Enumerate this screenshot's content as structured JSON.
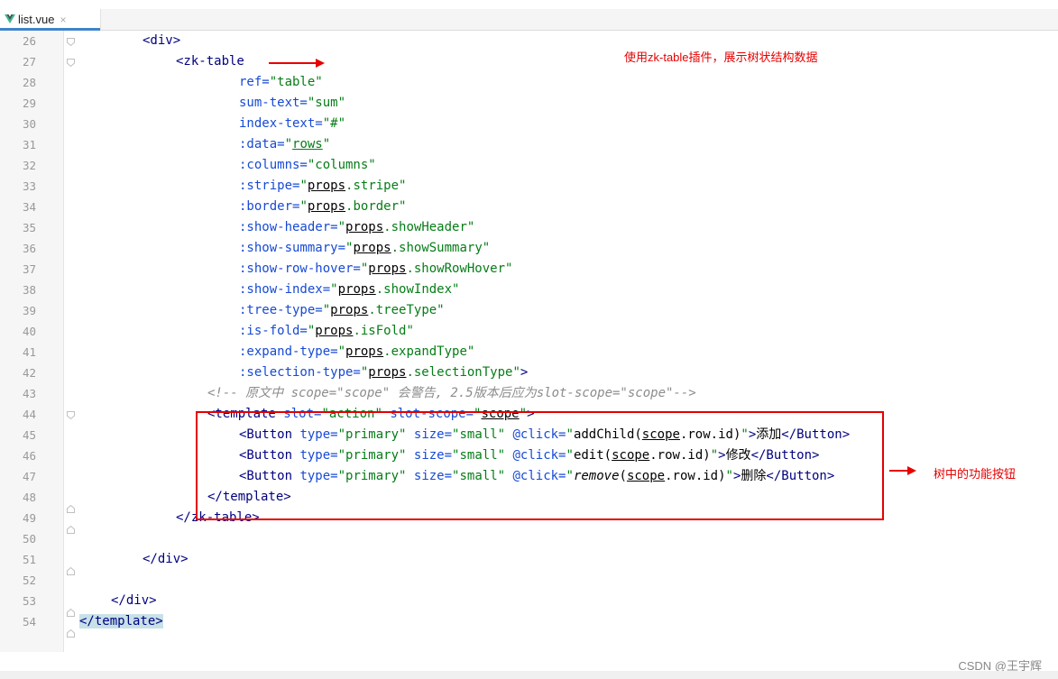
{
  "editor": {
    "tab": {
      "label": "list.vue",
      "close": "×"
    }
  },
  "annotations": {
    "top": "使用zk-table插件，展示树状结构数据",
    "right": "树中的功能按钮",
    "watermark": "CSDN @王宇辉"
  },
  "lines": [
    {
      "n": "26",
      "tokens": [
        [
          "t",
          "<div>"
        ]
      ],
      "indent": 70
    },
    {
      "n": "27",
      "tokens": [
        [
          "t",
          "<zk-table"
        ]
      ],
      "indent": 107
    },
    {
      "n": "28",
      "tokens": [
        [
          "a",
          "ref="
        ],
        [
          "s",
          "\"table\""
        ]
      ],
      "indent": 177
    },
    {
      "n": "29",
      "tokens": [
        [
          "a",
          "sum-text="
        ],
        [
          "s",
          "\"sum\""
        ]
      ],
      "indent": 177
    },
    {
      "n": "30",
      "tokens": [
        [
          "a",
          "index-text="
        ],
        [
          "s",
          "\"#\""
        ]
      ],
      "indent": 177
    },
    {
      "n": "31",
      "tokens": [
        [
          "a",
          ":data="
        ],
        [
          "s",
          "\""
        ],
        [
          "su",
          "rows"
        ],
        [
          "s",
          "\""
        ]
      ],
      "indent": 177
    },
    {
      "n": "32",
      "tokens": [
        [
          "a",
          ":columns="
        ],
        [
          "s",
          "\"columns\""
        ]
      ],
      "indent": 177
    },
    {
      "n": "33",
      "tokens": [
        [
          "a",
          ":stripe="
        ],
        [
          "s",
          "\""
        ],
        [
          "bu",
          "props"
        ],
        [
          "s",
          ".stripe\""
        ]
      ],
      "indent": 177
    },
    {
      "n": "34",
      "tokens": [
        [
          "a",
          ":border="
        ],
        [
          "s",
          "\""
        ],
        [
          "bu",
          "props"
        ],
        [
          "s",
          ".border\""
        ]
      ],
      "indent": 177
    },
    {
      "n": "35",
      "tokens": [
        [
          "a",
          ":show-header="
        ],
        [
          "s",
          "\""
        ],
        [
          "bu",
          "props"
        ],
        [
          "s",
          ".showHeader\""
        ]
      ],
      "indent": 177
    },
    {
      "n": "36",
      "tokens": [
        [
          "a",
          ":show-summary="
        ],
        [
          "s",
          "\""
        ],
        [
          "bu",
          "props"
        ],
        [
          "s",
          ".showSummary\""
        ]
      ],
      "indent": 177
    },
    {
      "n": "37",
      "tokens": [
        [
          "a",
          ":show-row-hover="
        ],
        [
          "s",
          "\""
        ],
        [
          "bu",
          "props"
        ],
        [
          "s",
          ".showRowHover\""
        ]
      ],
      "indent": 177
    },
    {
      "n": "38",
      "tokens": [
        [
          "a",
          ":show-index="
        ],
        [
          "s",
          "\""
        ],
        [
          "bu",
          "props"
        ],
        [
          "s",
          ".showIndex\""
        ]
      ],
      "indent": 177
    },
    {
      "n": "39",
      "tokens": [
        [
          "a",
          ":tree-type="
        ],
        [
          "s",
          "\""
        ],
        [
          "bu",
          "props"
        ],
        [
          "s",
          ".treeType\""
        ]
      ],
      "indent": 177
    },
    {
      "n": "40",
      "tokens": [
        [
          "a",
          ":is-fold="
        ],
        [
          "s",
          "\""
        ],
        [
          "bu",
          "props"
        ],
        [
          "s",
          ".isFold\""
        ]
      ],
      "indent": 177
    },
    {
      "n": "41",
      "tokens": [
        [
          "a",
          ":expand-type="
        ],
        [
          "s",
          "\""
        ],
        [
          "bu",
          "props"
        ],
        [
          "s",
          ".expandType\""
        ]
      ],
      "indent": 177
    },
    {
      "n": "42",
      "tokens": [
        [
          "a",
          ":selection-type="
        ],
        [
          "s",
          "\""
        ],
        [
          "bu",
          "props"
        ],
        [
          "s",
          ".selectionType\""
        ],
        [
          "t",
          ">"
        ]
      ],
      "indent": 177
    },
    {
      "n": "43",
      "tokens": [
        [
          "c",
          "<!-- 原文中 scope=\"scope\" 会警告, 2.5版本后应为slot-scope=\"scope\"-->"
        ]
      ],
      "indent": 142
    },
    {
      "n": "44",
      "tokens": [
        [
          "t",
          "<template "
        ],
        [
          "a",
          "slot="
        ],
        [
          "s",
          "\"action\" "
        ],
        [
          "a",
          "slot-scope="
        ],
        [
          "s",
          "\""
        ],
        [
          "bu",
          "scope"
        ],
        [
          "s",
          "\""
        ],
        [
          "t",
          ">"
        ]
      ],
      "indent": 142
    },
    {
      "n": "45",
      "tokens": [
        [
          "t",
          "<Button "
        ],
        [
          "a",
          "type="
        ],
        [
          "s",
          "\"primary\" "
        ],
        [
          "a",
          "size="
        ],
        [
          "s",
          "\"small\" "
        ],
        [
          "a",
          "@click="
        ],
        [
          "s",
          "\""
        ],
        [
          "b",
          "addChild("
        ],
        [
          "bu",
          "scope"
        ],
        [
          "b",
          ".row.id)"
        ],
        [
          "s",
          "\""
        ],
        [
          "t",
          ">"
        ],
        [
          "b",
          "添加"
        ],
        [
          "t",
          "</Button>"
        ]
      ],
      "indent": 177
    },
    {
      "n": "46",
      "tokens": [
        [
          "t",
          "<Button "
        ],
        [
          "a",
          "type="
        ],
        [
          "s",
          "\"primary\" "
        ],
        [
          "a",
          "size="
        ],
        [
          "s",
          "\"small\" "
        ],
        [
          "a",
          "@click="
        ],
        [
          "s",
          "\""
        ],
        [
          "b",
          "edit("
        ],
        [
          "bu",
          "scope"
        ],
        [
          "b",
          ".row.id)"
        ],
        [
          "s",
          "\""
        ],
        [
          "t",
          ">"
        ],
        [
          "b",
          "修改"
        ],
        [
          "t",
          "</Button>"
        ]
      ],
      "indent": 177
    },
    {
      "n": "47",
      "tokens": [
        [
          "t",
          "<Button "
        ],
        [
          "a",
          "type="
        ],
        [
          "s",
          "\"primary\" "
        ],
        [
          "a",
          "size="
        ],
        [
          "s",
          "\"small\" "
        ],
        [
          "a",
          "@click="
        ],
        [
          "s",
          "\""
        ],
        [
          "bi",
          "remove"
        ],
        [
          "b",
          "("
        ],
        [
          "bu",
          "scope"
        ],
        [
          "b",
          ".row.id)"
        ],
        [
          "s",
          "\""
        ],
        [
          "t",
          ">"
        ],
        [
          "b",
          "删除"
        ],
        [
          "t",
          "</Button>"
        ]
      ],
      "indent": 177
    },
    {
      "n": "48",
      "tokens": [
        [
          "t",
          "</template>"
        ]
      ],
      "indent": 142
    },
    {
      "n": "49",
      "tokens": [
        [
          "t",
          "</zk-table>"
        ]
      ],
      "indent": 107
    },
    {
      "n": "50",
      "tokens": [],
      "indent": 0
    },
    {
      "n": "51",
      "tokens": [
        [
          "t",
          "</div>"
        ]
      ],
      "indent": 70
    },
    {
      "n": "52",
      "tokens": [],
      "indent": 0
    },
    {
      "n": "53",
      "tokens": [
        [
          "t",
          "</div>"
        ]
      ],
      "indent": 35
    },
    {
      "n": "54",
      "tokens": [
        [
          "th",
          "</template>"
        ],
        [
          "t",
          ""
        ]
      ],
      "indent": 0
    }
  ]
}
